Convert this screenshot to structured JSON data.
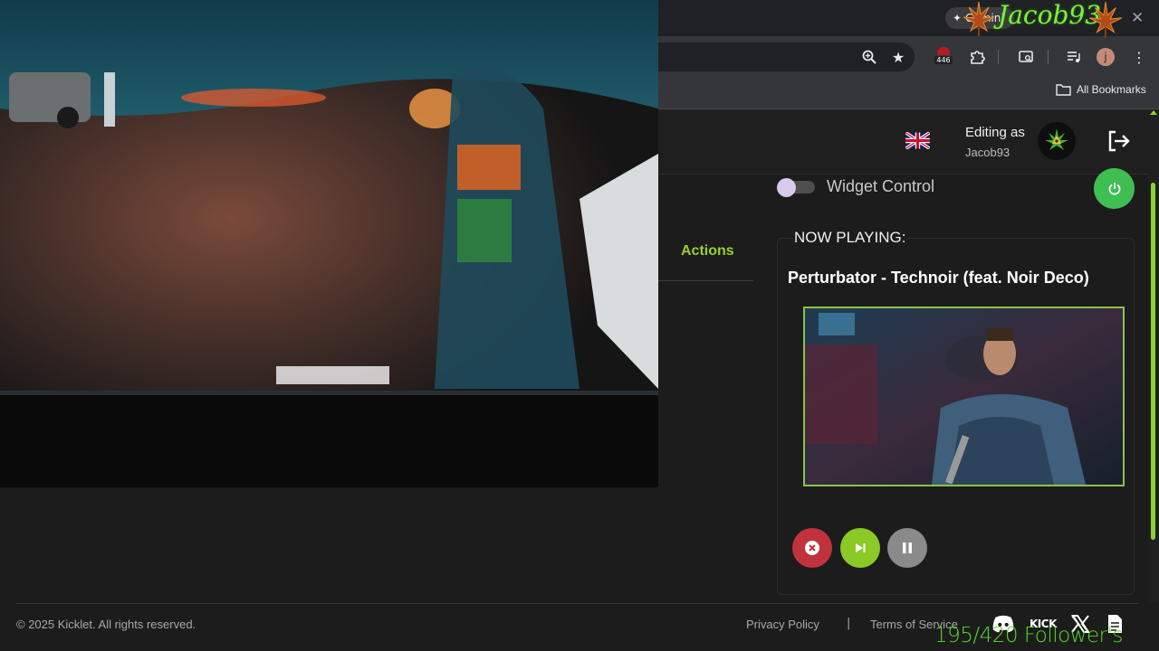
{
  "browser": {
    "gemini_label": "Gemini",
    "bookmarks_label": "All Bookmarks",
    "extension_badge": "446",
    "profile_initial": "j"
  },
  "header": {
    "editing_label": "Editing as",
    "username": "Jacob93"
  },
  "widget": {
    "control_label": "Widget Control"
  },
  "tabs": {
    "actions_label": "Actions"
  },
  "now_playing": {
    "label": "NOW PLAYING:",
    "title": "Perturbator - Technoir (feat. Noir Deco)"
  },
  "footer": {
    "copyright": "© 2025 Kicklet. All rights reserved.",
    "privacy": "Privacy Policy",
    "separator": "|",
    "terms": "Terms of Service",
    "kick_label": "KICK"
  },
  "overlay": {
    "streamer_name": "Jacob93",
    "follower_goal": "195/420 Follower's"
  },
  "colors": {
    "accent": "#8bc926",
    "stop": "#c0323c",
    "pause": "#8a8a8a",
    "power": "#3fbf52"
  }
}
